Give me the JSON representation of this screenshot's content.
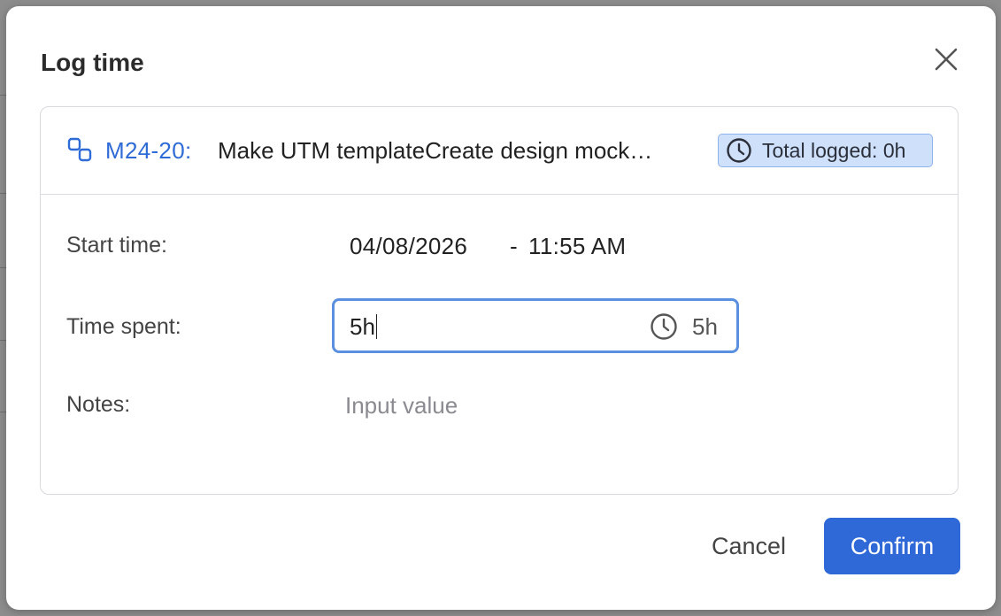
{
  "dialog": {
    "title": "Log time"
  },
  "task": {
    "key": "M24-20:",
    "title": "Make UTM templateCreate design mock…",
    "total_logged": "Total logged: 0h"
  },
  "fields": {
    "start_time_label": "Start time:",
    "start_date": "04/08/2026",
    "start_separator": "-",
    "start_time": "11:55 AM",
    "time_spent_label": "Time spent:",
    "time_spent_value": "5h",
    "time_spent_suffix": "5h",
    "notes_label": "Notes:",
    "notes_placeholder": "Input value"
  },
  "actions": {
    "cancel": "Cancel",
    "confirm": "Confirm"
  },
  "colors": {
    "accent": "#2f69d8",
    "link": "#2e6bd6",
    "badge_bg": "#cfe0fb",
    "focus_border": "#5b8fe0"
  },
  "icons": {
    "close": "close-icon",
    "task": "subtask-icon",
    "clock": "clock-icon"
  }
}
